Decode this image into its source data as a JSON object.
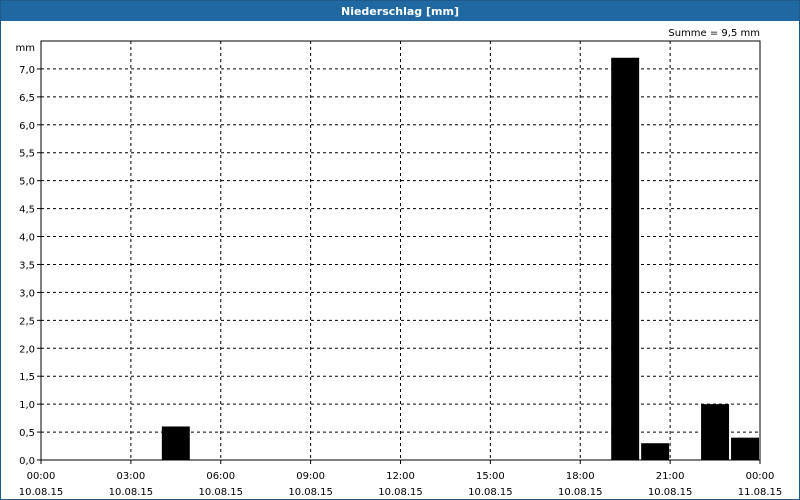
{
  "window": {
    "title": "Niederschlag [mm]"
  },
  "chart_data": {
    "type": "bar",
    "title": "Niederschlag [mm]",
    "ylabel": "mm",
    "summary": "Summe = 9,5 mm",
    "ylim": [
      0,
      7.5
    ],
    "yticks": [
      "0,0",
      "0,5",
      "1,0",
      "1,5",
      "2,0",
      "2,5",
      "3,0",
      "3,5",
      "4,0",
      "4,5",
      "5,0",
      "5,5",
      "6,0",
      "6,5",
      "7,0"
    ],
    "xlim_hours": [
      0,
      24
    ],
    "xticks": [
      {
        "time": "00:00",
        "date": "10.08.15"
      },
      {
        "time": "03:00",
        "date": "10.08.15"
      },
      {
        "time": "06:00",
        "date": "10.08.15"
      },
      {
        "time": "09:00",
        "date": "10.08.15"
      },
      {
        "time": "12:00",
        "date": "10.08.15"
      },
      {
        "time": "15:00",
        "date": "10.08.15"
      },
      {
        "time": "18:00",
        "date": "10.08.15"
      },
      {
        "time": "21:00",
        "date": "10.08.15"
      },
      {
        "time": "00:00",
        "date": "11.08.15"
      }
    ],
    "bars": [
      {
        "start": "04:00",
        "end": "05:00",
        "value": 0.6
      },
      {
        "start": "19:00",
        "end": "20:00",
        "value": 7.2
      },
      {
        "start": "20:00",
        "end": "21:00",
        "value": 0.3
      },
      {
        "start": "22:00",
        "end": "23:00",
        "value": 1.0
      },
      {
        "start": "23:00",
        "end": "00:00",
        "value": 0.4
      }
    ],
    "grid": true,
    "colors": {
      "bar": "#000000",
      "grid": "#000000",
      "header": "#2068a2"
    }
  }
}
